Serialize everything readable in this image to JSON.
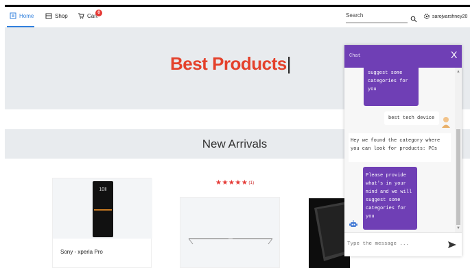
{
  "nav": {
    "home": "Home",
    "shop": "Shop",
    "cart": "Cart",
    "cart_count": "0",
    "search_placeholder": "Search",
    "username": "sarojvarshney20"
  },
  "hero": {
    "title": "Best Products",
    "caret": "|"
  },
  "arrivals": {
    "title": "New Arrivals"
  },
  "products": [
    {
      "name": "Sony - xperia Pro",
      "image_text": "10Ⅱ"
    },
    {
      "rating_stars": "★★★★★",
      "rating_count": "(1)"
    }
  ],
  "chat": {
    "title": "Chat",
    "close": "X",
    "messages": [
      {
        "from": "bot",
        "text": "mind and we will suggest some categories for you"
      },
      {
        "from": "user",
        "text": "best tech device"
      },
      {
        "from": "bot",
        "text": "Hey we found the category where you can look for products: PCs"
      },
      {
        "from": "bot",
        "text": "Please provide what's in your mind and we will suggest some categories for you"
      }
    ],
    "input_placeholder": "Type the message ..."
  },
  "colors": {
    "accent": "#6f3fb5",
    "brand_red": "#e4412b",
    "nav_active": "#2f7fdd"
  }
}
